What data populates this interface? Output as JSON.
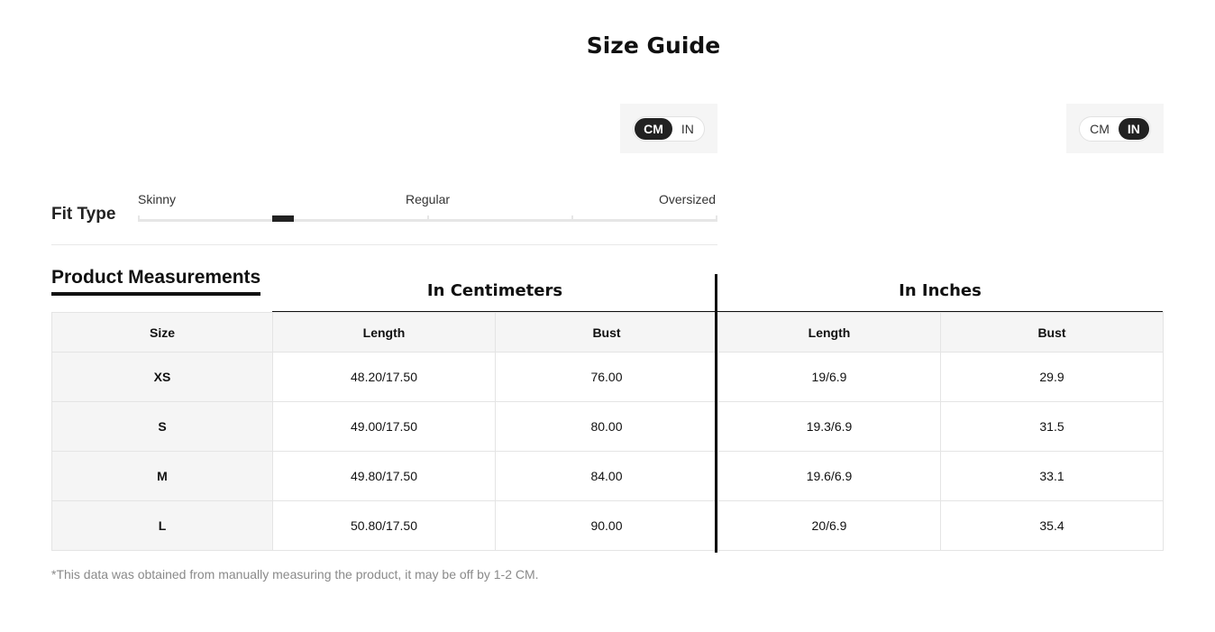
{
  "title": "Size Guide",
  "unit_toggles": [
    {
      "options": [
        "CM",
        "IN"
      ],
      "selected": "CM"
    },
    {
      "options": [
        "CM",
        "IN"
      ],
      "selected": "IN"
    }
  ],
  "fit_type": {
    "label": "Fit Type",
    "scale_labels": [
      "Skinny",
      "Regular",
      "Oversized"
    ],
    "selected_position": 0.25
  },
  "product_measurements": {
    "title": "Product Measurements",
    "group_headers": {
      "cm": "In Centimeters",
      "in": "In Inches"
    },
    "columns": [
      "Size",
      "Length",
      "Bust",
      "Length",
      "Bust"
    ],
    "rows": [
      [
        "XS",
        "48.20/17.50",
        "76.00",
        "19/6.9",
        "29.9"
      ],
      [
        "S",
        "49.00/17.50",
        "80.00",
        "19.3/6.9",
        "31.5"
      ],
      [
        "M",
        "49.80/17.50",
        "84.00",
        "19.6/6.9",
        "33.1"
      ],
      [
        "L",
        "50.80/17.50",
        "90.00",
        "20/6.9",
        "35.4"
      ]
    ]
  },
  "note": "*This data was obtained from manually measuring the product, it may be off by 1-2 CM."
}
